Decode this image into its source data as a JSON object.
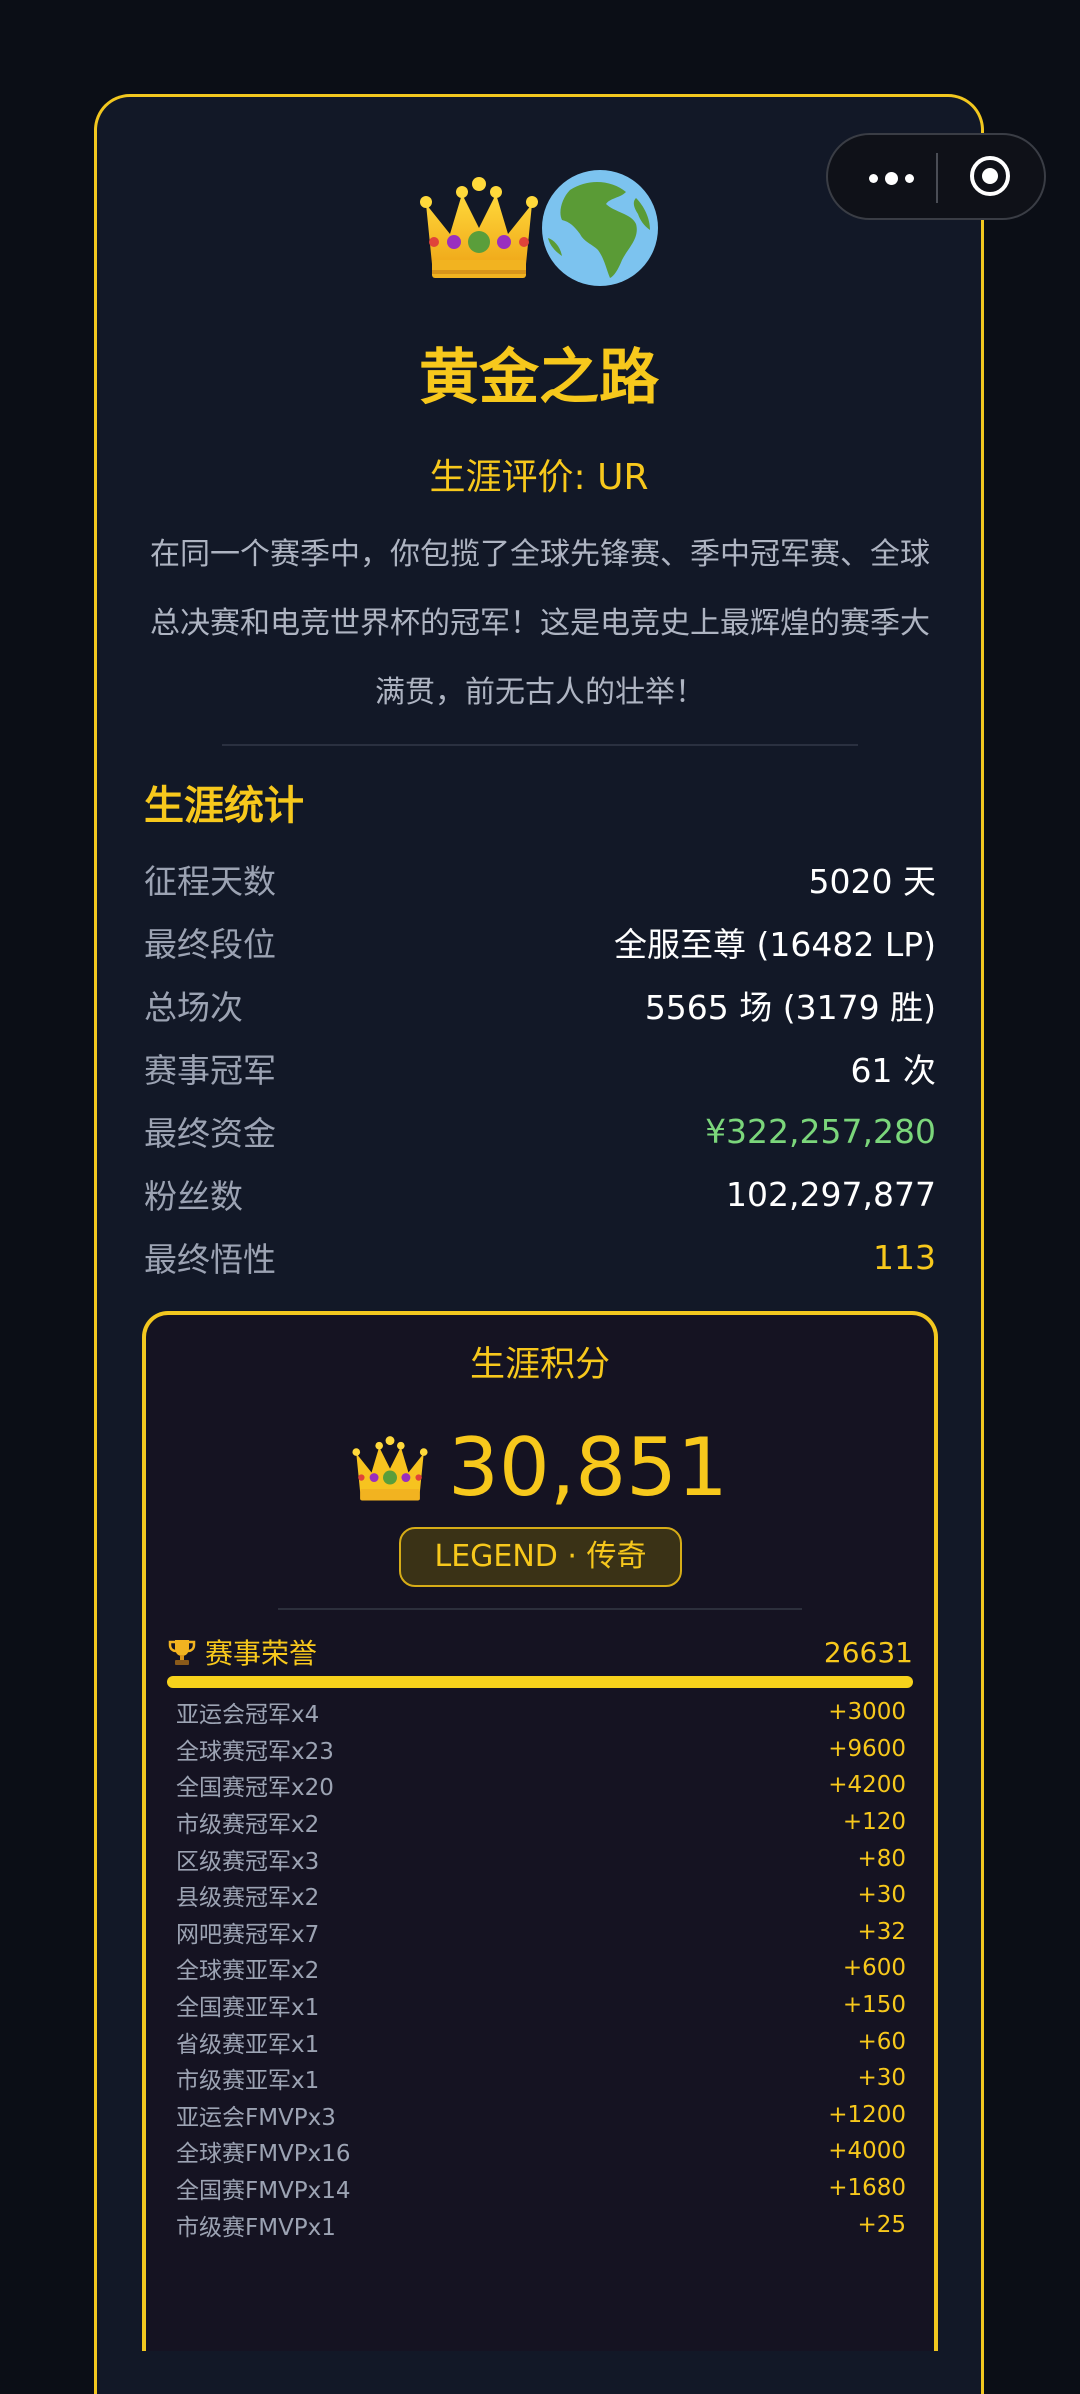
{
  "capsule": {
    "more_icon": "more-dots-icon",
    "close_icon": "target-circle-icon"
  },
  "hero": {
    "icons": [
      "crown-icon",
      "globe-africa-icon"
    ]
  },
  "title": "黄金之路",
  "rating": "生涯评价: UR",
  "description": "在同一个赛季中，你包揽了全球先锋赛、季中冠军赛、全球总决赛和电竞世界杯的冠军！这是电竞史上最辉煌的赛季大满贯，前无古人的壮举！",
  "stats": {
    "heading": "生涯统计",
    "rows": [
      {
        "label": "征程天数",
        "value": "5020 天"
      },
      {
        "label": "最终段位",
        "value": "全服至尊 (16482 LP)"
      },
      {
        "label": "总场次",
        "value": "5565 场 (3179 胜)"
      },
      {
        "label": "赛事冠军",
        "value": "61 次"
      },
      {
        "label": "最终资金",
        "value": "¥322,257,280"
      },
      {
        "label": "粉丝数",
        "value": "102,297,877"
      },
      {
        "label": "最终悟性",
        "value": "113"
      }
    ]
  },
  "score": {
    "title": "生涯积分",
    "value": "30,851",
    "badge": "LEGEND · 传奇"
  },
  "honors": {
    "icon": "trophy-icon",
    "label": "赛事荣誉",
    "total": "26631",
    "items": [
      {
        "name": "亚运会冠军x4",
        "points": "+3000"
      },
      {
        "name": "全球赛冠军x23",
        "points": "+9600"
      },
      {
        "name": "全国赛冠军x20",
        "points": "+4200"
      },
      {
        "name": "市级赛冠军x2",
        "points": "+120"
      },
      {
        "name": "区级赛冠军x3",
        "points": "+80"
      },
      {
        "name": "县级赛冠军x2",
        "points": "+30"
      },
      {
        "name": "网吧赛冠军x7",
        "points": "+32"
      },
      {
        "name": "全球赛亚军x2",
        "points": "+600"
      },
      {
        "name": "全国赛亚军x1",
        "points": "+150"
      },
      {
        "name": "省级赛亚军x1",
        "points": "+60"
      },
      {
        "name": "市级赛亚军x1",
        "points": "+30"
      },
      {
        "name": "亚运会FMVPx3",
        "points": "+1200"
      },
      {
        "name": "全球赛FMVPx16",
        "points": "+4000"
      },
      {
        "name": "全国赛FMVPx14",
        "points": "+1680"
      },
      {
        "name": "市级赛FMVPx1",
        "points": "+25"
      }
    ]
  },
  "colors": {
    "accent": "#f7c81c",
    "background": "#0b0e16",
    "card": "#121827",
    "money": "#7bd67b"
  }
}
